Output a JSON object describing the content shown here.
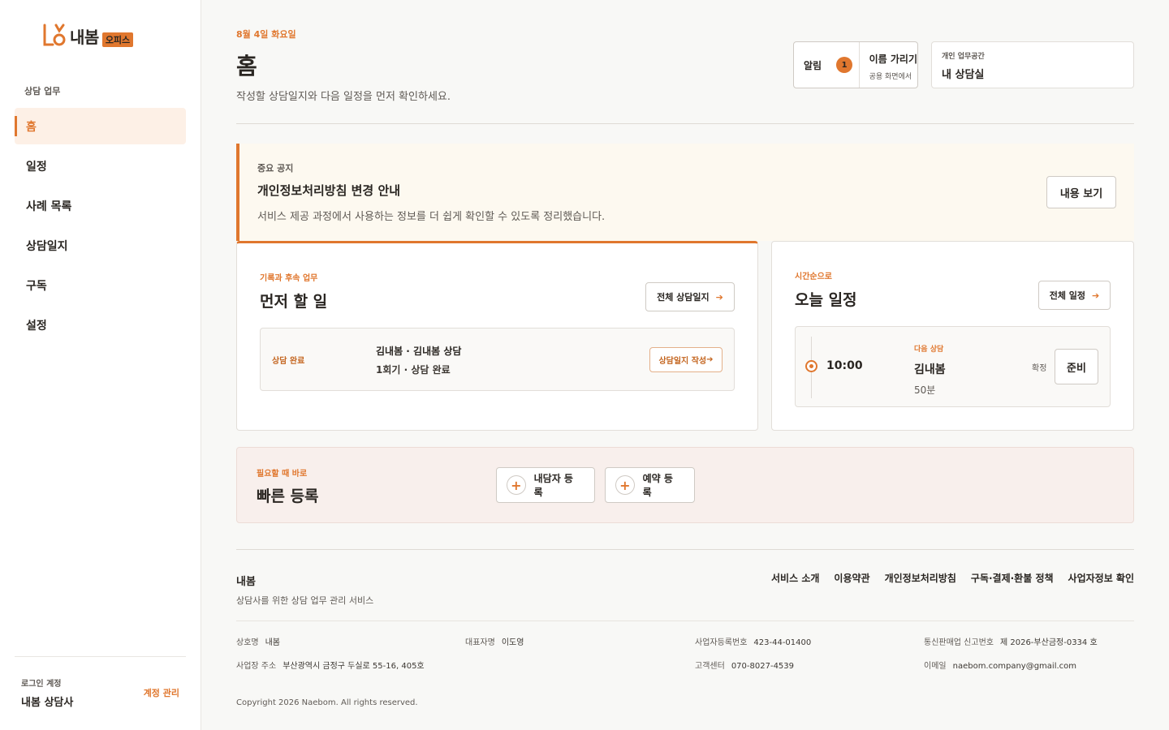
{
  "brand": {
    "name": "내봄",
    "badge": "오피스"
  },
  "sidebar": {
    "section_label": "상담 업무",
    "items": [
      {
        "label": "홈"
      },
      {
        "label": "일정"
      },
      {
        "label": "사례 목록"
      },
      {
        "label": "상담일지"
      },
      {
        "label": "구독"
      },
      {
        "label": "설정"
      }
    ],
    "account": {
      "label": "로그인 계정",
      "name": "내봄 상담사",
      "manage": "계정 관리"
    }
  },
  "header": {
    "date": "8월 4일 화요일",
    "title": "홈",
    "subtitle": "작성할 상담일지와 다음 일정을 먼저 확인하세요.",
    "alerts": {
      "label": "알림",
      "count": "1"
    },
    "hide_names": {
      "title": "이름 가리기",
      "desc": "공용 화면에서"
    },
    "workspace": {
      "label": "개인 업무공간",
      "name": "내 상담실"
    }
  },
  "notice": {
    "label": "중요 공지",
    "title": "개인정보처리방침 변경 안내",
    "body": "서비스 제공 과정에서 사용하는 정보를 더 쉽게 확인할 수 있도록 정리했습니다.",
    "button": "내용 보기"
  },
  "todo": {
    "label": "기록과 후속 업무",
    "title": "먼저 할 일",
    "button": "전체 상담일지",
    "item": {
      "status": "상담 완료",
      "who": "김내봄 · 김내봄 상담",
      "meta": "1회기 · 상담 완료",
      "action": "상담일지 작성"
    }
  },
  "today": {
    "label": "시간순으로",
    "title": "오늘 일정",
    "button": "전체 일정",
    "item": {
      "time": "10:00",
      "tag": "다음 상담",
      "client": "김내봄",
      "duration": "50분",
      "status": "확정",
      "action": "준비"
    }
  },
  "quick": {
    "label": "필요할 때 바로",
    "title": "빠른 등록",
    "buttons": [
      "내담자 등록",
      "예약 등록"
    ]
  },
  "footer": {
    "brand": "내봄",
    "desc": "상담사를 위한 상담 업무 관리 서비스",
    "links": [
      "서비스 소개",
      "이용약관",
      "개인정보처리방침",
      "구독·결제·환불 정책",
      "사업자정보 확인"
    ],
    "info": {
      "company_k": "상호명",
      "company_v": "내봄",
      "ceo_k": "대표자명",
      "ceo_v": "이도영",
      "biz_k": "사업자등록번호",
      "biz_v": "423-44-01400",
      "ecom_k": "통신판매업 신고번호",
      "ecom_v": "제 2026-부산금정-0334 호",
      "addr_k": "사업장 주소",
      "addr_v": "부산광역시 금정구 두실로 55-16, 405호",
      "cs_k": "고객센터",
      "cs_v": "070-8027-4539",
      "email_k": "이메일",
      "email_v": "naebom.company@gmail.com"
    },
    "copyright": "Copyright 2026 Naebom. All rights reserved."
  },
  "colors": {
    "accent": "#e0772e",
    "accent_bg": "#fdf0e6",
    "notice_bg": "#fdf9f0",
    "quick_bg": "#f8efec"
  }
}
